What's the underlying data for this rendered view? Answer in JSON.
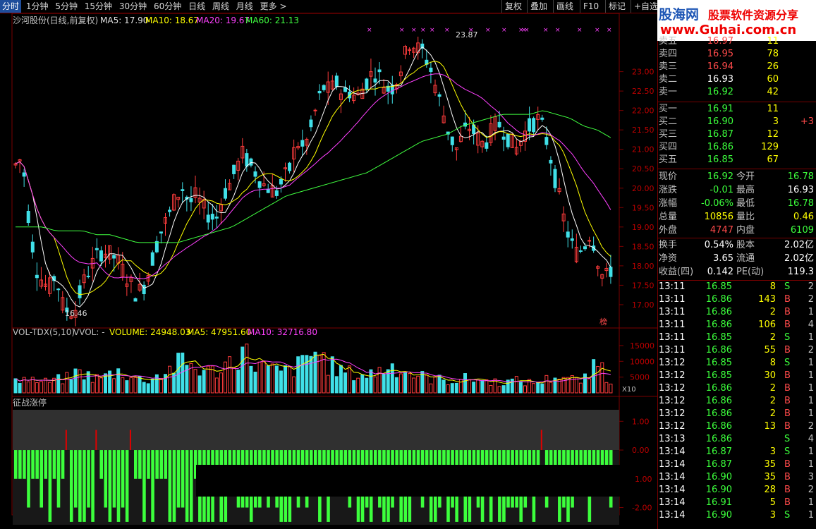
{
  "toolbar": {
    "tabs": [
      "分时",
      "1分钟",
      "5分钟",
      "15分钟",
      "30分钟",
      "60分钟",
      "日线",
      "周线",
      "月线",
      "更多 >"
    ],
    "buttons": [
      "复权",
      "叠加",
      "画线",
      "F10",
      "标记",
      "+自选"
    ]
  },
  "main_chart": {
    "header": {
      "title": "沙河股份(日线,前复权)",
      "ma5": "MA5: 17.90",
      "ma10": "MA10: 18.67",
      "ma20": "MA20: 19.67",
      "ma60": "MA60: 21.13"
    },
    "high_label": "23.87",
    "low_label": "16.46",
    "corner_tag": "榜",
    "colors": {
      "up": "#ff3c3c",
      "down": "#40e0e8",
      "ma5": "#ffffff",
      "ma10": "#ffff00",
      "ma20": "#ff40ff",
      "ma60": "#40ff40",
      "grid": "#7a0000"
    }
  },
  "volume_chart": {
    "header": {
      "name": "VOL-TDX(5,10)",
      "vvol": "VVOL: -",
      "volume": "VOLUME: 24948.03",
      "ma5": "MA5: 47951.60",
      "ma10": "MA10: 32716.80"
    },
    "unit": "X10"
  },
  "indicator_chart": {
    "name": "征战涨停"
  },
  "chart_data": [
    {
      "type": "candlestick",
      "title": "沙河股份(日线,前复权)",
      "ylim": [
        16.4,
        24.1
      ],
      "y_ticks": [
        "23.00",
        "22.50",
        "22.00",
        "21.50",
        "21.00",
        "20.50",
        "20.00",
        "19.50",
        "19.00",
        "18.50",
        "18.00",
        "17.50",
        "17.00"
      ],
      "close_path": [
        20.6,
        20.8,
        19.2,
        18.0,
        17.6,
        17.4,
        17.8,
        17.0,
        16.8,
        16.9,
        17.5,
        17.9,
        18.2,
        18.4,
        18.3,
        18.2,
        17.9,
        17.6,
        17.3,
        17.4,
        17.9,
        18.5,
        19.0,
        19.3,
        19.8,
        20.0,
        19.6,
        19.8,
        19.5,
        19.3,
        19.2,
        19.8,
        20.1,
        20.5,
        20.9,
        20.6,
        20.4,
        20.1,
        20.0,
        19.9,
        20.2,
        20.5,
        21.2,
        21.0,
        21.4,
        22.1,
        22.6,
        22.5,
        22.7,
        22.4,
        22.5,
        22.3,
        22.6,
        22.9,
        23.0,
        22.7,
        22.5,
        22.8,
        23.3,
        23.8,
        23.6,
        23.5,
        23.1,
        22.5,
        21.9,
        21.3,
        21.0,
        21.4,
        21.6,
        21.3,
        21.1,
        21.4,
        21.7,
        21.5,
        21.2,
        21.0,
        21.4,
        21.6,
        21.8,
        21.5,
        20.8,
        20.0,
        19.2,
        18.6,
        18.3,
        18.5,
        18.9,
        18.2,
        17.6,
        17.9
      ],
      "ma60_path": [
        19.0,
        19.0,
        19.0,
        18.9,
        18.9,
        18.9,
        18.8,
        18.8,
        18.7,
        18.6,
        18.6,
        18.6,
        18.6,
        18.7,
        18.8,
        18.9,
        19.0,
        19.2,
        19.4,
        19.6,
        19.8,
        19.9,
        20.0,
        20.1,
        20.2,
        20.3,
        20.4,
        20.6,
        20.8,
        21.0,
        21.2,
        21.3,
        21.4,
        21.6,
        21.7,
        21.8,
        21.9,
        21.9,
        21.9,
        22.0,
        21.9,
        21.8,
        21.6,
        21.5,
        21.3
      ],
      "series": [
        {
          "name": "MA5",
          "value": 17.9
        },
        {
          "name": "MA10",
          "value": 18.67
        },
        {
          "name": "MA20",
          "value": 19.67
        },
        {
          "name": "MA60",
          "value": 21.13
        }
      ],
      "annotations": [
        {
          "text": "23.87"
        },
        {
          "text": "16.46"
        }
      ]
    },
    {
      "type": "bar",
      "title": "VOL-TDX(5,10)",
      "ylim": [
        0,
        17000
      ],
      "y_ticks": [
        "15000",
        "10000",
        "5000"
      ],
      "volume_path": [
        6000,
        4500,
        5000,
        4000,
        3500,
        3800,
        4200,
        4600,
        5000,
        6500,
        7000,
        5500,
        4800,
        5200,
        6000,
        7200,
        6800,
        5600,
        4800,
        4200,
        4600,
        5500,
        6500,
        7800,
        9000,
        10500,
        9500,
        8200,
        7600,
        7000,
        7400,
        8500,
        10500,
        12000,
        14500,
        11000,
        9800,
        8600,
        7600,
        7200,
        6800,
        7500,
        8500,
        10000,
        12500,
        14000,
        11500,
        9000,
        8000,
        7000,
        6500,
        6000,
        5800,
        6200,
        7000,
        8000,
        9000,
        8500,
        7500,
        6500,
        5800,
        5200,
        4800,
        4500,
        4200,
        4000,
        4300,
        4600,
        4800,
        4400,
        4000,
        3800,
        3600,
        3500,
        3800,
        4000,
        3600,
        3400,
        3600,
        4000,
        5000,
        6000,
        5200,
        4600,
        4000,
        4400,
        5000,
        16000,
        5200,
        3800
      ],
      "series": [
        {
          "name": "VOLUME",
          "value": 24948.03
        },
        {
          "name": "MA5",
          "value": 47951.6
        },
        {
          "name": "MA10",
          "value": 32716.8
        }
      ]
    },
    {
      "type": "bar",
      "title": "征战涨停",
      "ylim": [
        -2.6,
        1.4
      ],
      "y_ticks": [
        "1.00",
        "0.00",
        "-1.00",
        "-2.00"
      ],
      "red_bars": [
        12,
        19,
        27,
        123
      ]
    }
  ],
  "quote_panel": {
    "ad": {
      "brand": "股海网",
      "slogan": "股票软件资源分享",
      "url": "www.Guhai.com.cn"
    },
    "asks": [
      {
        "label": "卖五",
        "price": "16.97",
        "vol": "11"
      },
      {
        "label": "卖四",
        "price": "16.95",
        "vol": "78"
      },
      {
        "label": "卖三",
        "price": "16.94",
        "vol": "26"
      },
      {
        "label": "卖二",
        "price": "16.93",
        "vol": "60"
      },
      {
        "label": "卖一",
        "price": "16.92",
        "vol": "42"
      }
    ],
    "bids": [
      {
        "label": "买一",
        "price": "16.91",
        "vol": "11",
        "chg": ""
      },
      {
        "label": "买二",
        "price": "16.90",
        "vol": "3",
        "chg": "+3"
      },
      {
        "label": "买三",
        "price": "16.87",
        "vol": "12",
        "chg": ""
      },
      {
        "label": "买四",
        "price": "16.86",
        "vol": "129",
        "chg": ""
      },
      {
        "label": "买五",
        "price": "16.85",
        "vol": "67",
        "chg": ""
      }
    ],
    "stats": [
      {
        "l1": "现价",
        "v1": "16.92",
        "l2": "今开",
        "v2": "16.78"
      },
      {
        "l1": "涨跌",
        "v1": "-0.01",
        "l2": "最高",
        "v2": "16.93"
      },
      {
        "l1": "涨幅",
        "v1": "-0.06%",
        "l2": "最低",
        "v2": "16.78"
      },
      {
        "l1": "总量",
        "v1": "10856",
        "l2": "量比",
        "v2": "0.46"
      },
      {
        "l1": "外盘",
        "v1": "4747",
        "l2": "内盘",
        "v2": "6109"
      }
    ],
    "fin": [
      {
        "l1": "换手",
        "v1": "0.54%",
        "l2": "股本",
        "v2": "2.02亿"
      },
      {
        "l1": "净资",
        "v1": "3.65",
        "l2": "流通",
        "v2": "2.02亿"
      },
      {
        "l1": "收益(四)",
        "v1": "0.142",
        "l2": "PE(动)",
        "v2": "119.3"
      }
    ],
    "ticks": [
      {
        "time": "13:11",
        "price": "16.85",
        "vol": "8",
        "bs": "S",
        "n": "2"
      },
      {
        "time": "13:11",
        "price": "16.86",
        "vol": "143",
        "bs": "B",
        "n": "2"
      },
      {
        "time": "13:11",
        "price": "16.86",
        "vol": "2",
        "bs": "B",
        "n": "1"
      },
      {
        "time": "13:11",
        "price": "16.86",
        "vol": "106",
        "bs": "B",
        "n": "4"
      },
      {
        "time": "13:11",
        "price": "16.85",
        "vol": "2",
        "bs": "S",
        "n": "1"
      },
      {
        "time": "13:11",
        "price": "16.86",
        "vol": "55",
        "bs": "B",
        "n": "2"
      },
      {
        "time": "13:12",
        "price": "16.85",
        "vol": "8",
        "bs": "S",
        "n": "1"
      },
      {
        "time": "13:12",
        "price": "16.85",
        "vol": "30",
        "bs": "B",
        "n": "1"
      },
      {
        "time": "13:12",
        "price": "16.86",
        "vol": "2",
        "bs": "B",
        "n": "1"
      },
      {
        "time": "13:12",
        "price": "16.86",
        "vol": "2",
        "bs": "B",
        "n": "1"
      },
      {
        "time": "13:12",
        "price": "16.86",
        "vol": "2",
        "bs": "B",
        "n": "1"
      },
      {
        "time": "13:12",
        "price": "16.86",
        "vol": "13",
        "bs": "B",
        "n": "2"
      },
      {
        "time": "13:13",
        "price": "16.86",
        "vol": "",
        "bs": "S",
        "n": "4"
      },
      {
        "time": "13:14",
        "price": "16.87",
        "vol": "3",
        "bs": "S",
        "n": "1"
      },
      {
        "time": "13:14",
        "price": "16.87",
        "vol": "35",
        "bs": "B",
        "n": "1"
      },
      {
        "time": "13:14",
        "price": "16.90",
        "vol": "35",
        "bs": "B",
        "n": "3"
      },
      {
        "time": "13:14",
        "price": "16.90",
        "vol": "28",
        "bs": "B",
        "n": "2"
      },
      {
        "time": "13:14",
        "price": "16.91",
        "vol": "5",
        "bs": "B",
        "n": "1"
      },
      {
        "time": "13:14",
        "price": "16.90",
        "vol": "3",
        "bs": "S",
        "n": "1"
      }
    ]
  }
}
